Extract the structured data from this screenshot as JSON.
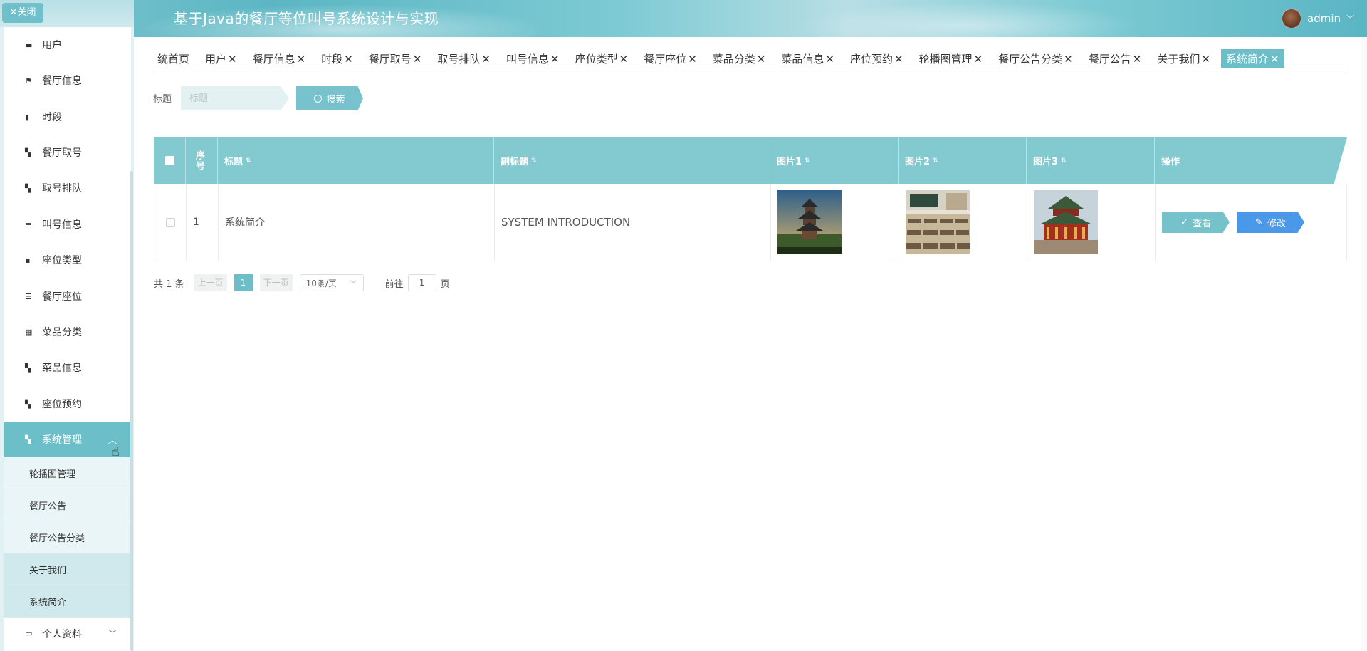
{
  "app": {
    "title": "基于Java的餐厅等位叫号系统设计与实现",
    "user": "admin"
  },
  "sidebar": {
    "close_label": "✕关闭",
    "items": [
      {
        "label": "用户",
        "icon": "user-icon"
      },
      {
        "label": "餐厅信息",
        "icon": "flag-icon"
      },
      {
        "label": "时段",
        "icon": "chart-icon"
      },
      {
        "label": "餐厅取号",
        "icon": "grid-icon"
      },
      {
        "label": "取号排队",
        "icon": "grid-icon"
      },
      {
        "label": "叫号信息",
        "icon": "list-icon"
      },
      {
        "label": "座位类型",
        "icon": "chat-icon"
      },
      {
        "label": "餐厅座位",
        "icon": "sliders-icon"
      },
      {
        "label": "菜品分类",
        "icon": "apps-icon"
      },
      {
        "label": "菜品信息",
        "icon": "grid-icon"
      },
      {
        "label": "座位预约",
        "icon": "grid-icon"
      },
      {
        "label": "系统管理",
        "icon": "grid-icon"
      }
    ],
    "subitems": [
      "轮播图管理",
      "餐厅公告",
      "餐厅公告分类",
      "关于我们",
      "系统简介"
    ],
    "profile_label": "个人资料"
  },
  "tags": [
    {
      "label": "统首页",
      "closable": false
    },
    {
      "label": "用户",
      "closable": true
    },
    {
      "label": "餐厅信息",
      "closable": true
    },
    {
      "label": "时段",
      "closable": true
    },
    {
      "label": "餐厅取号",
      "closable": true
    },
    {
      "label": "取号排队",
      "closable": true
    },
    {
      "label": "叫号信息",
      "closable": true
    },
    {
      "label": "座位类型",
      "closable": true
    },
    {
      "label": "餐厅座位",
      "closable": true
    },
    {
      "label": "菜品分类",
      "closable": true
    },
    {
      "label": "菜品信息",
      "closable": true
    },
    {
      "label": "座位预约",
      "closable": true
    },
    {
      "label": "轮播图管理",
      "closable": true
    },
    {
      "label": "餐厅公告分类",
      "closable": true
    },
    {
      "label": "餐厅公告",
      "closable": true
    },
    {
      "label": "关于我们",
      "closable": true
    },
    {
      "label": "系统简介",
      "closable": true,
      "active": true
    }
  ],
  "search": {
    "label": "标题",
    "placeholder": "标题",
    "button": "搜索"
  },
  "table": {
    "headers": [
      "序号",
      "标题",
      "副标题",
      "图片1",
      "图片2",
      "图片3",
      "操作"
    ],
    "rows": [
      {
        "index": "1",
        "title": "系统简介",
        "subtitle": "SYSTEM INTRODUCTION"
      }
    ],
    "view_label": "查看",
    "edit_label": "修改"
  },
  "pagination": {
    "total": "共 1 条",
    "prev": "上一页",
    "current": "1",
    "next": "下一页",
    "page_size": "10条/页",
    "goto": "前往",
    "goto_value": "1",
    "page_unit": "页"
  },
  "colors": {
    "accent": "#6cbec9",
    "table_header": "#83c9d0",
    "edit_button": "#4a98e8"
  }
}
